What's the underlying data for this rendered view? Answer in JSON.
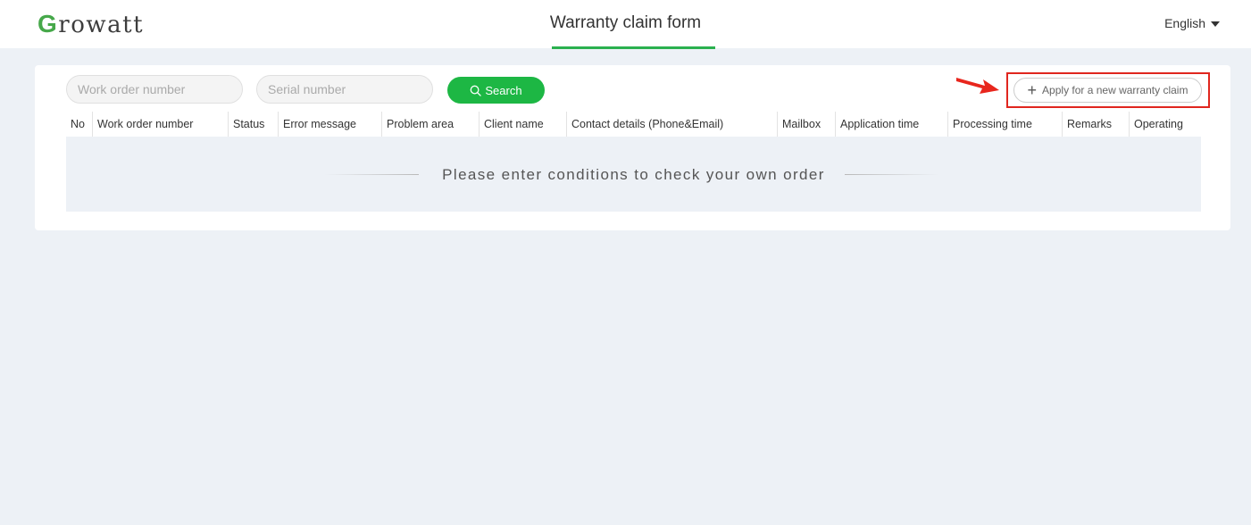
{
  "header": {
    "logo_initial": "G",
    "logo_rest": "rowatt",
    "title": "Warranty claim form",
    "language": "English"
  },
  "filters": {
    "work_order_placeholder": "Work order number",
    "serial_placeholder": "Serial number",
    "search_label": "Search"
  },
  "actions": {
    "apply_label": "Apply for a new warranty claim"
  },
  "table": {
    "columns": [
      "No",
      "Work order number",
      "Status",
      "Error message",
      "Problem area",
      "Client name",
      "Contact details (Phone&Email)",
      "Mailbox",
      "Application time",
      "Processing time",
      "Remarks",
      "Operating"
    ],
    "empty_message": "Please enter conditions to check your own order"
  },
  "colors": {
    "brand_green": "#1db744",
    "logo_green": "#46a84a",
    "highlight_red": "#e0261e",
    "page_bg": "#edf1f6"
  },
  "icons": {
    "search": "search-icon",
    "plus": "plus-icon",
    "caret": "caret-down-icon",
    "annotation_arrow": "arrow-icon"
  }
}
